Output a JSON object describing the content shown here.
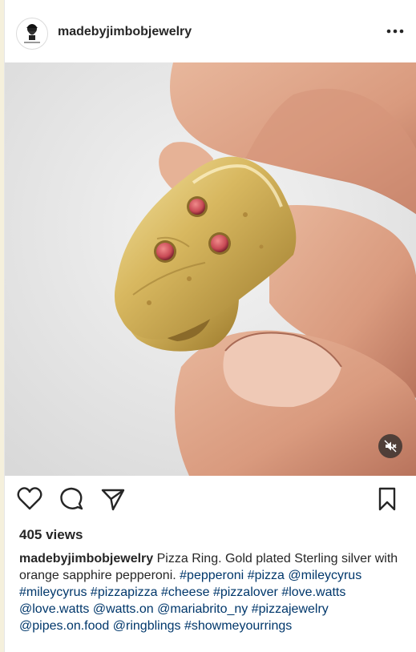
{
  "post": {
    "username": "madebyjimbobjewelry",
    "views": "405 views",
    "caption": {
      "username": "madebyjimbobjewelry",
      "text": " Pizza Ring. Gold plated Sterling silver with orange sapphire pepperoni. ",
      "tags": [
        "#pepperoni",
        "#pizza",
        "@mileycyrus",
        "#mileycyrus",
        "#pizzapizza",
        "#cheese",
        "#pizzalover",
        "#love.watts",
        "@love.watts",
        "@watts.on",
        "@mariabrito_ny",
        "#pizzajewelry",
        "@pipes.on.food",
        "@ringblings",
        "#showmeyourrings"
      ]
    }
  },
  "icons": {
    "avatar": "avatar",
    "more": "more-horizontal-icon",
    "mute": "muted-speaker-icon",
    "like": "heart-icon",
    "comment": "comment-icon",
    "share": "paper-plane-icon",
    "save": "bookmark-icon"
  },
  "colors": {
    "link": "#00376b",
    "text": "#262626",
    "background": "#f5f0dc"
  }
}
